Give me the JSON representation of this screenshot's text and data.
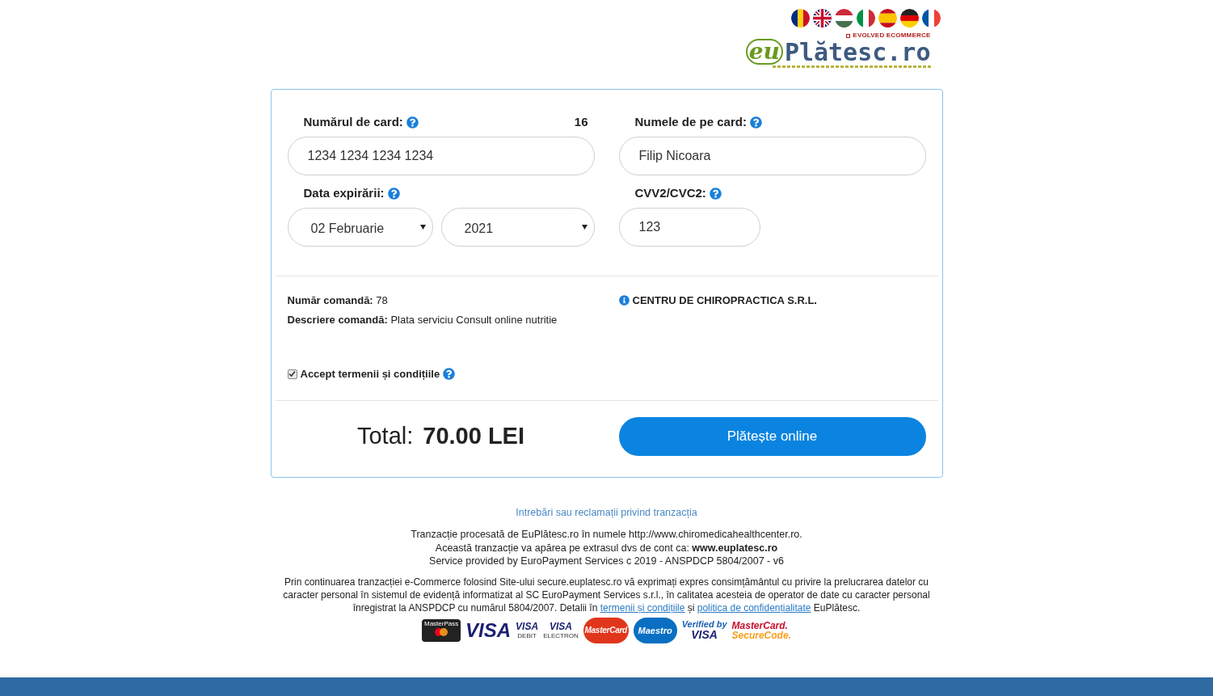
{
  "languages": [
    {
      "kind": "ro"
    },
    {
      "kind": "gb"
    },
    {
      "kind": "hu"
    },
    {
      "kind": "it"
    },
    {
      "kind": "es"
    },
    {
      "kind": "de"
    },
    {
      "kind": "fr"
    }
  ],
  "logo": {
    "tagline": "EVOLVED ECOMMERCE",
    "mark": "eu",
    "name": "Plătesc.ro"
  },
  "form": {
    "card_number": {
      "label": "Numărul de card:",
      "counter": "16",
      "value": "1234 1234 1234 1234"
    },
    "card_name": {
      "label": "Numele de pe card:",
      "value": "Filip Nicoara"
    },
    "expiry": {
      "label": "Data expirării:",
      "month": "02 Februarie",
      "year": "2021"
    },
    "cvv": {
      "label": "CVV2/CVC2:",
      "value": "123"
    }
  },
  "order": {
    "lines": [
      "**Număr comandă:** 78",
      "**Descriere comandă:** Plata serviciu Consult online nutritie"
    ],
    "merchant": "CENTRU DE CHIROPRACTICA S.R.L."
  },
  "terms": {
    "label": "Accept termenii și condițiile",
    "checked": true
  },
  "total": {
    "label": "Total:",
    "amount": "70.00 LEI"
  },
  "pay_button": "Plătește online",
  "footer": {
    "complaints_link": "Intrebări sau reclamații privind tranzacția",
    "lines": [
      "Tranzacție procesată de EuPlătesc.ro în numele http://www.chiromedicahealthcenter.ro.",
      "Această tranzacție va apărea pe extrasul dvs de cont ca: **www.euplatesc.ro**",
      "Service provided by EuroPayment Services c 2019 - ANSPDCP 5804/2007 - v6"
    ],
    "legal": [
      {
        "kind": "text",
        "text": "Prin continuarea tranzacției e-Commerce folosind Site-ului secure.euplatesc.ro vă exprimați expres consimțământul cu privire la prelucrarea datelor cu caracter personal în sistemul de evidență informatizat al SC EuroPayment Services s.r.l., în calitatea acesteia de operator de date cu caracter personal înregistrat la ANSPDCP cu numărul 5804/2007. Detalii în "
      },
      {
        "kind": "link",
        "text": "termenii și condițiile"
      },
      {
        "kind": "text",
        "text": " și "
      },
      {
        "kind": "link",
        "text": "politica de confidențialitate"
      },
      {
        "kind": "text",
        "text": " EuPlătesc."
      }
    ]
  },
  "payment_logos": [
    {
      "kind": "masterpass",
      "text": "MasterPass"
    },
    {
      "kind": "visa",
      "text": "VISA"
    },
    {
      "kind": "visa_small",
      "text": "VISA",
      "sub": "DEBIT"
    },
    {
      "kind": "visa_small",
      "text": "VISA",
      "sub": "ELECTRON"
    },
    {
      "kind": "mastercard",
      "text": "MasterCard"
    },
    {
      "kind": "maestro",
      "text": "Maestro"
    },
    {
      "kind": "verified",
      "text": "Verified by",
      "sub": "VISA"
    },
    {
      "kind": "securecode",
      "text": "MasterCard.",
      "sub": "SecureCode."
    }
  ]
}
